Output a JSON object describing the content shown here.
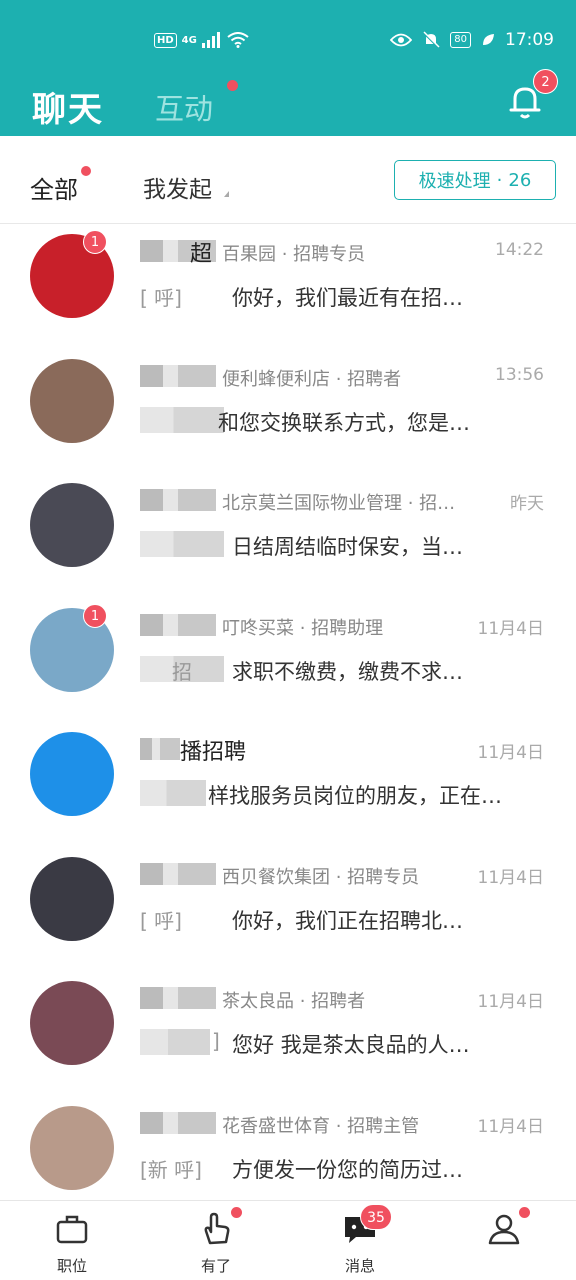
{
  "status_bar": {
    "hd": "HD",
    "net": "4G",
    "battery": "80",
    "time": "17:09"
  },
  "header": {
    "tab_chat": "聊天",
    "tab_interaction": "互动",
    "bell_badge": "2"
  },
  "filter": {
    "all": "全部",
    "mine": "我发起",
    "quick_label": "极速处理",
    "quick_count": "26"
  },
  "messages": [
    {
      "name": "超",
      "meta": "百果园 · 招聘专员",
      "time": "14:22",
      "prefix": "[  呼]",
      "text": "你好，我们最近有在招…",
      "badge": "1",
      "avatar_color": "#c8202a"
    },
    {
      "name": "",
      "meta": "便利蜂便利店 · 招聘者",
      "time": "13:56",
      "prefix": "",
      "text": "和您交换联系方式，您是…",
      "badge": "",
      "avatar_color": "#8a6a5a"
    },
    {
      "name": "",
      "meta": "北京莫兰国际物业管理 · 招…",
      "time": "昨天",
      "prefix": "",
      "text": "日结周结临时保安，当…",
      "badge": "",
      "avatar_color": "#4a4a55"
    },
    {
      "name": "",
      "meta": "叮咚买菜 · 招聘助理",
      "time": "11月4日",
      "prefix": "招",
      "text": "求职不缴费，缴费不求…",
      "badge": "1",
      "avatar_color": "#7aa8c8"
    },
    {
      "name": "播招聘",
      "meta": "",
      "time": "11月4日",
      "prefix": "",
      "text": "样找服务员岗位的朋友，正在…",
      "badge": "",
      "avatar_color": "#1e90e8"
    },
    {
      "name": "",
      "meta": "西贝餐饮集团 · 招聘专员",
      "time": "11月4日",
      "prefix": "[  呼]",
      "text": "你好，我们正在招聘北…",
      "badge": "",
      "avatar_color": "#3a3a44"
    },
    {
      "name": "",
      "meta": "茶太良品 · 招聘者",
      "time": "11月4日",
      "prefix": "]",
      "text": "您好 我是茶太良品的人…",
      "badge": "",
      "avatar_color": "#7a4a55"
    },
    {
      "name": "",
      "meta": "花香盛世体育 · 招聘主管",
      "time": "11月4日",
      "prefix": "[新  呼]",
      "text": "方便发一份您的简历过…",
      "badge": "",
      "avatar_color": "#b89a8a"
    }
  ],
  "nav": {
    "jobs": "职位",
    "youle": "有了",
    "messages": "消息",
    "messages_badge": "35",
    "profile": ""
  },
  "colors": {
    "brand": "#1db0b0",
    "badge": "#f0505f"
  }
}
